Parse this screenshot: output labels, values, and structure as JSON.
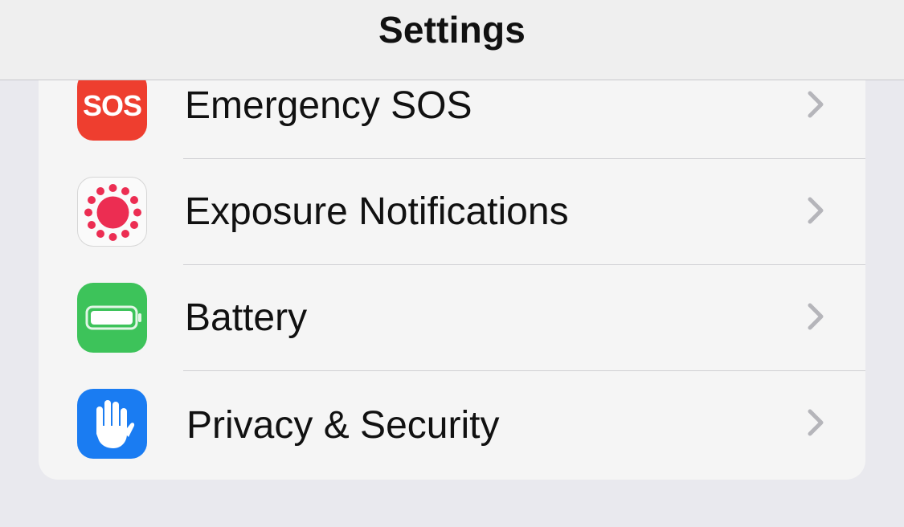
{
  "header": {
    "title": "Settings"
  },
  "rows": [
    {
      "label": "Emergency SOS",
      "icon": "sos-icon",
      "icon_text": "SOS",
      "icon_color": "#ee3e2f"
    },
    {
      "label": "Exposure Notifications",
      "icon": "exposure-notifications-icon",
      "icon_color": "#ec2d52"
    },
    {
      "label": "Battery",
      "icon": "battery-icon",
      "icon_color": "#3dc35a"
    },
    {
      "label": "Privacy & Security",
      "icon": "hand-icon",
      "icon_color": "#1a7cf2"
    }
  ],
  "chevron_icon": "chevron-right-icon",
  "colors": {
    "background": "#e9e9ee",
    "card": "#f5f5f5",
    "chevron": "#b5b5ba"
  }
}
